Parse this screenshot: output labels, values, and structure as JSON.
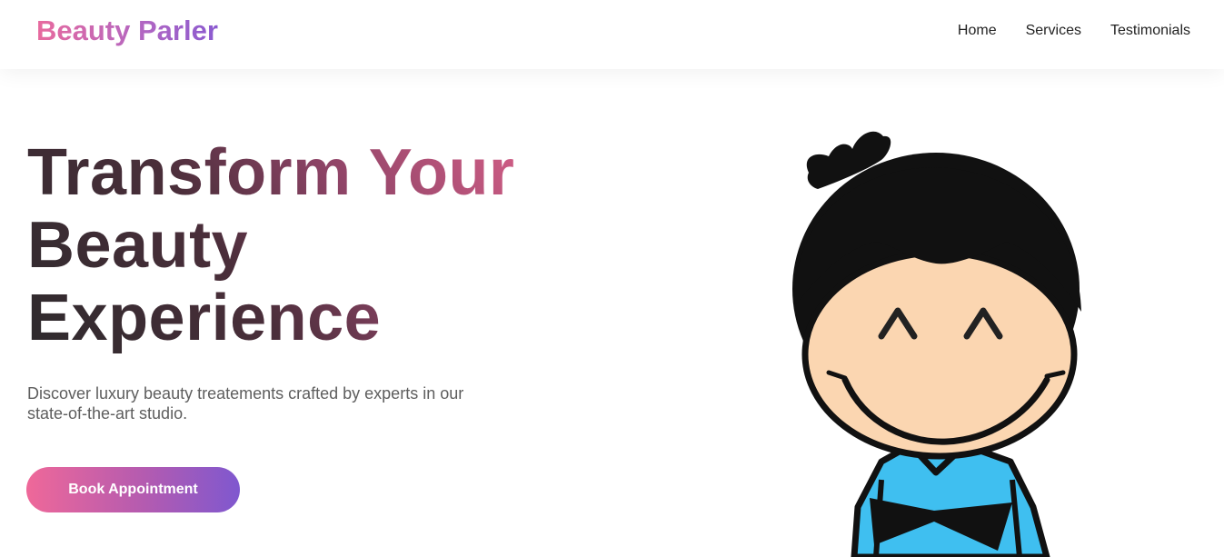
{
  "navbar": {
    "brand": "Beauty Parler",
    "links": [
      "Home",
      "Services",
      "Testimonials"
    ]
  },
  "hero": {
    "title_lines": [
      "Transform Your",
      "Beauty",
      "Experience"
    ],
    "description": "Discover luxury beauty treatements crafted by experts in our state-of-the-art studio.",
    "cta_label": "Book Appointment"
  },
  "colors": {
    "brand_pink": "#e86a9e",
    "brand_purple": "#8a5ad0",
    "mascot_skin": "#fbd6b1",
    "mascot_shirt": "#3fbff0",
    "mascot_hair": "#111111"
  },
  "images": {
    "hero_mascot": "cartoon-boy-smiling"
  }
}
